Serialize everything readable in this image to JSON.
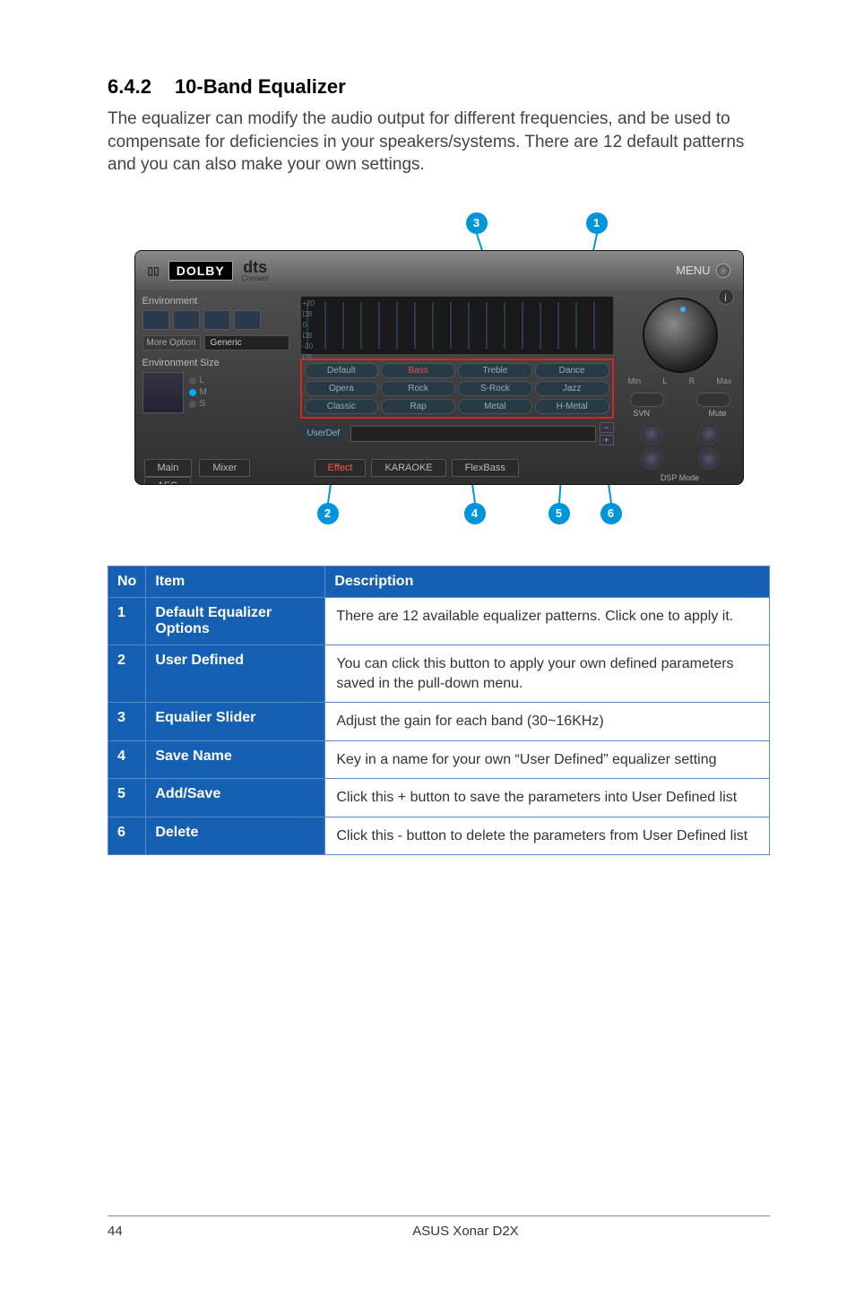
{
  "heading_number": "6.4.2",
  "heading_title": "10-Band Equalizer",
  "intro": "The equalizer can modify the audio output for different frequencies, and be used to compensate for deficiencies in your speakers/systems. There are 12 default patterns and you can also make your own settings.",
  "screenshot": {
    "dolby_logo": "DOLBY",
    "dts_logo": "dts",
    "dts_sub": "Connect",
    "menu_label": "MENU",
    "env_label": "Environment",
    "more_option": "More Option",
    "more_option_value": "Generic",
    "env_size_label": "Environment Size",
    "size_options": [
      "L",
      "M",
      "S"
    ],
    "eq_db_labels": "+20\nDB\n0\nDB\n-20\nDB",
    "presets": [
      "Default",
      "Bass",
      "Treble",
      "Dance",
      "Opera",
      "Rock",
      "S-Rock",
      "Jazz",
      "Classic",
      "Rap",
      "Metal",
      "H-Metal"
    ],
    "userdef_label": "UserDef",
    "tabs_left": [
      "Main",
      "Mixer"
    ],
    "tab_aec": "AEC",
    "tabs_mid": [
      "Effect",
      "KARAOKE",
      "FlexBass"
    ],
    "knob_min": "Min",
    "knob_l": "L",
    "knob_r": "R",
    "knob_max": "Max",
    "svn": "SVN",
    "mute": "Mute",
    "dsp_label": "DSP Mode"
  },
  "callouts": {
    "1": "1",
    "2": "2",
    "3": "3",
    "4": "4",
    "5": "5",
    "6": "6"
  },
  "table": {
    "headers": {
      "no": "No",
      "item": "Item",
      "description": "Description"
    },
    "rows": [
      {
        "no": "1",
        "item": "Default Equalizer Options",
        "desc": "There are 12 available equalizer patterns. Click one to apply it."
      },
      {
        "no": "2",
        "item": "User Defined",
        "desc": "You can click this button to apply your own defined parameters saved in the pull-down menu."
      },
      {
        "no": "3",
        "item": "Equalier Slider",
        "desc": "Adjust the gain for each band (30~16KHz)"
      },
      {
        "no": "4",
        "item": "Save Name",
        "desc": "Key in a name for your own “User Defined” equalizer setting"
      },
      {
        "no": "5",
        "item": "Add/Save",
        "desc": "Click this + button to save the parameters into User Defined list"
      },
      {
        "no": "6",
        "item": "Delete",
        "desc": "Click this - button to delete the parameters from User Defined list"
      }
    ]
  },
  "footer": {
    "page": "44",
    "title": "ASUS Xonar D2X"
  }
}
